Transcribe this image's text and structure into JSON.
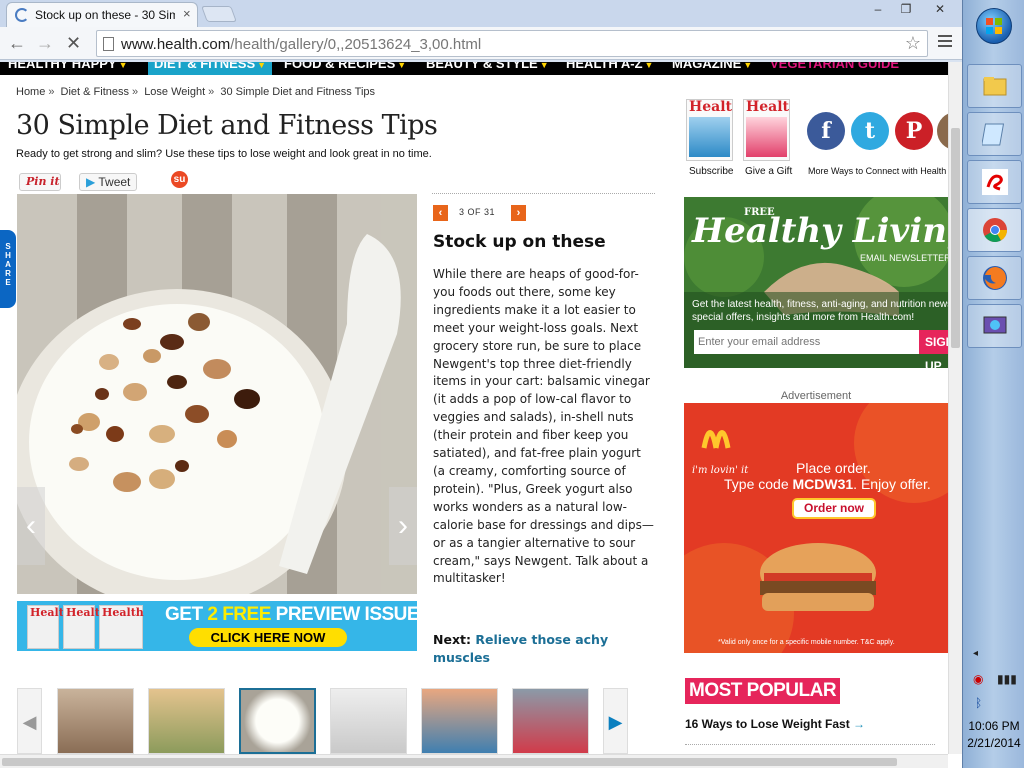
{
  "browser": {
    "tab_title": "Stock up on these - 30 Sim",
    "tab_close": "×",
    "url_host": "www.health.com",
    "url_path": "/health/gallery/0,,20513624_3,00.html",
    "minimize": "–",
    "restore": "❐",
    "close": "✕",
    "back": "←",
    "forward": "→",
    "stop": "✕",
    "bookmark_star": "☆"
  },
  "site_nav": [
    {
      "label": "HEALTHY HAPPY"
    },
    {
      "label": "DIET & FITNESS"
    },
    {
      "label": "FOOD & RECIPES"
    },
    {
      "label": "BEAUTY & STYLE"
    },
    {
      "label": "HEALTH A-Z"
    },
    {
      "label": "MAGAZINE"
    },
    {
      "label": "VEGETARIAN GUIDE"
    }
  ],
  "breadcrumb": [
    "Home",
    "Diet & Fitness",
    "Lose Weight",
    "30 Simple Diet and Fitness Tips"
  ],
  "breadcrumb_sep": "»",
  "page": {
    "title": "30 Simple Diet and Fitness Tips",
    "subtitle": "Ready to get strong and slim? Use these tips to lose weight and look great in no time."
  },
  "social": {
    "pinit": "Pin it",
    "tweet": "Tweet",
    "stumble": "su",
    "share_tab": "SHARE"
  },
  "slide": {
    "counter": "3 OF 31",
    "prev": "‹",
    "next": "›",
    "title": "Stock up on these",
    "body": "While there are heaps of good-for-you foods out there, some key ingredients make it a lot easier to meet your weight-loss goals. Next grocery store run, be sure to place Newgent's top three diet-friendly items in your cart: balsamic vinegar (it adds a pop of low-cal flavor to veggies and salads), in-shell nuts (their protein and fiber keep you satiated), and fat-free plain yogurt (a creamy, comforting source of protein). \"Plus, Greek yogurt also works wonders as a natural low-calorie base for dressings and dips—or as a tangier alternative to sour cream,\" says Newgent. Talk about a multitasker!",
    "next_label": "Next:",
    "next_link": "Relieve those achy muscles",
    "hero_prev": "‹",
    "hero_next": "›"
  },
  "promo": {
    "mag_text": "Health",
    "headline_pre": "GET ",
    "headline_num": "2 FREE",
    "headline_post": " PREVIEW ISSUES!",
    "cta": "CLICK HERE NOW"
  },
  "thumb_strip": {
    "prev": "◀",
    "next": "▶",
    "selected_index": 2
  },
  "sidebar": {
    "mag_text": "Health",
    "subscribe": "Subscribe",
    "give_gift": "Give a Gift",
    "more_ways": "More Ways to Connect with Health",
    "facebook": "f",
    "twitter": "t",
    "pinterest": "P"
  },
  "newsletter": {
    "free": "FREE",
    "title": "Healthy Living",
    "kicker": "EMAIL NEWSLETTER",
    "description": "Get the latest health, fitness, anti-aging, and nutrition news, plus special offers, insights and more from Health.com!",
    "placeholder": "Enter your email address",
    "signup": "SIGN UP"
  },
  "ad": {
    "label": "Advertisement",
    "slogan": "i'm lovin' it",
    "line1": "Place order.",
    "line2_pre": "Type code ",
    "code": "MCDW31",
    "line2_post": ". Enjoy offer.",
    "button": "Order now",
    "fine_print": "*Valid only once for a specific mobile number. T&C apply."
  },
  "most_popular": {
    "heading": "MOST POPULAR",
    "item1": "16 Ways to Lose Weight Fast",
    "item1_arrow": "→"
  },
  "taskbar": {
    "time": "10:06 PM",
    "date": "2/21/2014",
    "tray_expand": "◂",
    "bluetooth": "ᛒ"
  }
}
